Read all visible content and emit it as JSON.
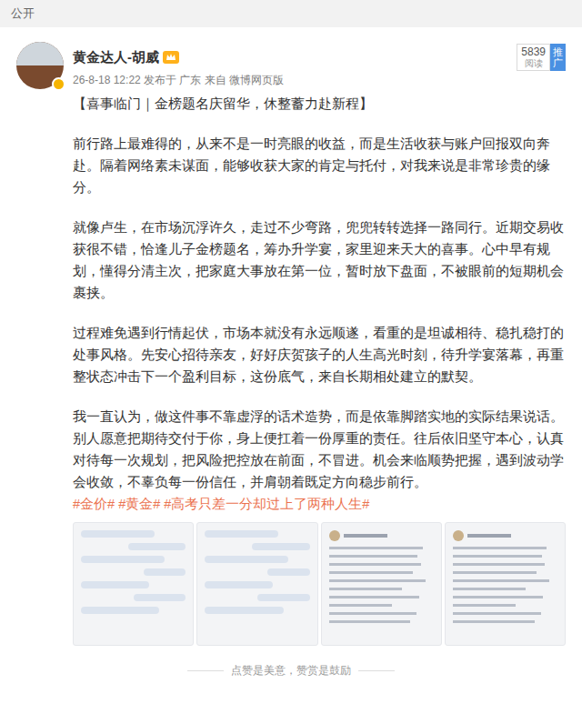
{
  "visibility": "公开",
  "author": {
    "name": "黄金达人-胡威",
    "meta": "26-8-18 12:22 发布于 广东 来自 微博网页版"
  },
  "stats": {
    "reads": "5839",
    "reads_label": "阅读",
    "promote": "推广"
  },
  "title": "【喜事临门｜金榜题名庆留华，休整蓄力赴新程】",
  "paragraphs": [
    "前行路上最难得的，从来不是一时亮眼的收益，而是生活收获与账户回报双向奔赴。隔着网络素未谋面，能够收获大家的肯定与托付，对我来说是非常珍贵的缘分。",
    "就像卢生，在市场沉浮许久，走过不少弯路，兜兜转转选择一路同行。近期交易收获很不错，恰逢儿子金榜题名，筹办升学宴，家里迎来天大的喜事。心中早有规划，懂得分清主次，把家庭大事放在第一位，暂时放下盘面，不被眼前的短期机会裹挟。",
    "过程难免遇到行情起伏，市场本就没有永远顺遂，看重的是坦诚相待、稳扎稳打的处事风格。先安心招待亲友，好好庆贺孩子的人生高光时刻，待升学宴落幕，再重整状态冲击下一个盈利目标，这份底气，来自长期相处建立的默契。",
    "我一直认为，做这件事不靠虚浮的话术造势，而是依靠脚踏实地的实际结果说话。别人愿意把期待交付于你，身上便扛着一份厚重的责任。往后依旧坚守本心，认真对待每一次规划，把风险把控放在前面，不冒进。机会来临顺势把握，遇到波动学会收敛，不辜负每一份信任，并肩朝着既定方向稳步前行。"
  ],
  "hashtags": [
    "#金价#",
    "#黄金#",
    "#高考只差一分却过上了两种人生#"
  ],
  "images": [
    {
      "kind": "chat"
    },
    {
      "kind": "chat"
    },
    {
      "kind": "post"
    },
    {
      "kind": "post"
    }
  ],
  "footer": "点赞是美意，赞赏是鼓励"
}
